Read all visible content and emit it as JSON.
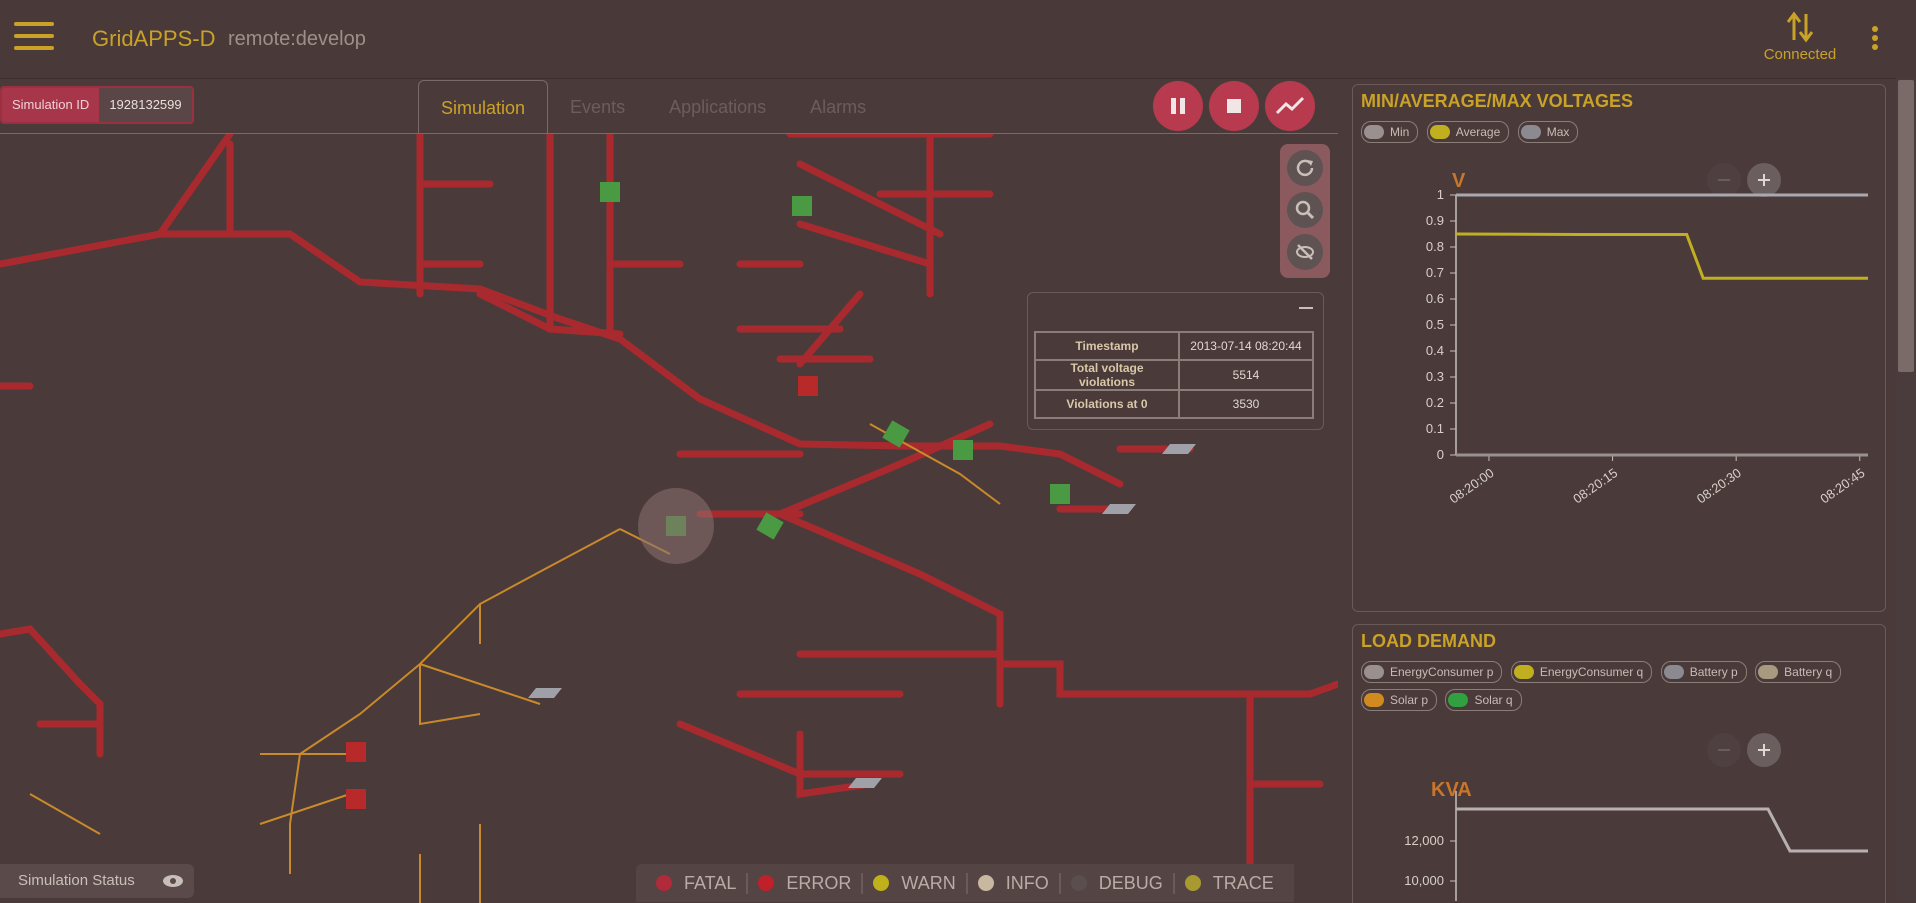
{
  "header": {
    "title": "GridAPPS-D",
    "subtitle": "remote:develop",
    "connection_status": "Connected"
  },
  "simulation": {
    "id_label": "Simulation ID",
    "id_value": "1928132599"
  },
  "tabs": [
    {
      "label": "Simulation",
      "active": true
    },
    {
      "label": "Events",
      "active": false
    },
    {
      "label": "Applications",
      "active": false
    },
    {
      "label": "Alarms",
      "active": false
    }
  ],
  "controls": [
    "pause-icon",
    "stop-icon",
    "chart-icon"
  ],
  "map_controls": [
    "reset-icon",
    "zoom-icon",
    "visibility-off-icon"
  ],
  "voltage_overlay": {
    "rows": [
      {
        "key": "Timestamp",
        "value": "2013-07-14 08:20:44"
      },
      {
        "key": "Total voltage violations",
        "value": "5514"
      },
      {
        "key": "Violations at 0",
        "value": "3530"
      }
    ]
  },
  "status_bar": {
    "label": "Simulation Status"
  },
  "log_levels": [
    {
      "label": "FATAL",
      "color": "#b02a3a"
    },
    {
      "label": "ERROR",
      "color": "#c0202a"
    },
    {
      "label": "WARN",
      "color": "#c0b01a"
    },
    {
      "label": "INFO",
      "color": "#c8b8a0"
    },
    {
      "label": "DEBUG",
      "color": "#5a4e4e"
    },
    {
      "label": "TRACE",
      "color": "#a89a30"
    }
  ],
  "voltage_panel": {
    "title": "MIN/AVERAGE/MAX VOLTAGES",
    "legend": [
      {
        "label": "Min",
        "color": "#9a9090"
      },
      {
        "label": "Average",
        "color": "#c0b020"
      },
      {
        "label": "Max",
        "color": "#8a8a90"
      }
    ],
    "y_unit": "V"
  },
  "load_panel": {
    "title": "LOAD DEMAND",
    "legend": [
      {
        "label": "EnergyConsumer p",
        "color": "#9a9090"
      },
      {
        "label": "EnergyConsumer q",
        "color": "#c0b020"
      },
      {
        "label": "Battery p",
        "color": "#8a8a90"
      },
      {
        "label": "Battery q",
        "color": "#a89a80"
      },
      {
        "label": "Solar p",
        "color": "#d08a20"
      },
      {
        "label": "Solar q",
        "color": "#30a040"
      }
    ],
    "y_unit": "KVA",
    "y_ticks": [
      "12,000",
      "10,000"
    ]
  },
  "chart_data": [
    {
      "type": "line",
      "title": "MIN/AVERAGE/MAX VOLTAGES",
      "ylabel": "V",
      "ylim": [
        0,
        1
      ],
      "y_ticks": [
        "0",
        "0.1",
        "0.2",
        "0.3",
        "0.4",
        "0.5",
        "0.6",
        "0.7",
        "0.8",
        "0.9",
        "1"
      ],
      "x_ticks": [
        "08:20:00",
        "08:20:15",
        "08:20:30",
        "08:20:45"
      ],
      "series": [
        {
          "name": "Max",
          "color": "#a8a8b0",
          "x": [
            "08:19:56",
            "08:20:46"
          ],
          "values": [
            1.0,
            1.0
          ]
        },
        {
          "name": "Average",
          "color": "#c0b020",
          "x": [
            "08:19:56",
            "08:20:11",
            "08:20:24",
            "08:20:26",
            "08:20:46"
          ],
          "values": [
            0.85,
            0.848,
            0.848,
            0.68,
            0.68
          ]
        },
        {
          "name": "Min",
          "color": "#9a9090",
          "x": [
            "08:19:56",
            "08:20:46"
          ],
          "values": [
            0.0,
            0.0
          ]
        }
      ]
    },
    {
      "type": "line",
      "title": "LOAD DEMAND",
      "ylabel": "KVA",
      "series": [
        {
          "name": "EnergyConsumer p",
          "color": "#b8b0b0",
          "x": [
            0,
            1,
            2,
            3
          ],
          "values": [
            13600,
            13600,
            11500,
            11500
          ]
        }
      ]
    }
  ]
}
